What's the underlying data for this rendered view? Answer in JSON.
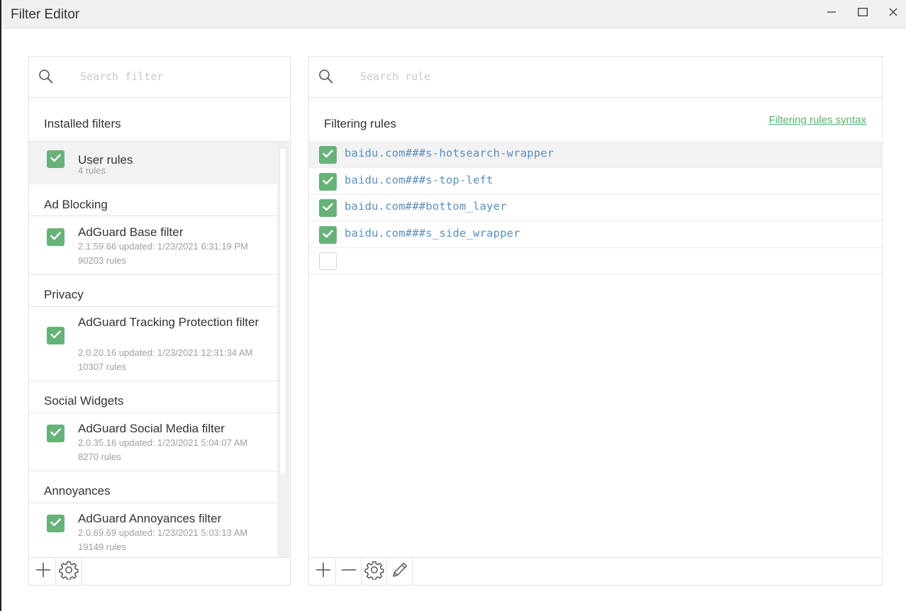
{
  "window": {
    "title": "Filter Editor",
    "minimize_icon": "minimize-icon",
    "maximize_icon": "maximize-icon",
    "close_icon": "close-icon"
  },
  "left_panel": {
    "search": {
      "placeholder": "Search filter",
      "value": ""
    },
    "installed_header": "Installed filters",
    "user_rules": {
      "name": "User rules",
      "meta": "4 rules",
      "checked": true
    },
    "groups": [
      {
        "header": "Ad Blocking",
        "filter": {
          "name": "AdGuard Base filter",
          "version": "2.1.59.66 updated: 1/23/2021 6:31:19 PM",
          "rules": "90203 rules",
          "checked": true
        }
      },
      {
        "header": "Privacy",
        "filter": {
          "name": "AdGuard Tracking Protection filter",
          "version": "2.0.20.16 updated: 1/23/2021 12:31:34 AM",
          "rules": "10307 rules",
          "checked": true
        }
      },
      {
        "header": "Social Widgets",
        "filter": {
          "name": "AdGuard Social Media filter",
          "version": "2.0.35.16 updated: 1/23/2021 5:04:07 AM",
          "rules": "8270 rules",
          "checked": true
        }
      },
      {
        "header": "Annoyances",
        "filter": {
          "name": "AdGuard Annoyances filter",
          "version": "2.0.69.69 updated: 1/23/2021 5:03:13 AM",
          "rules": "19149 rules",
          "checked": true
        }
      }
    ],
    "toolbar": [
      "plus-icon",
      "gear-icon"
    ]
  },
  "right_panel": {
    "search": {
      "placeholder": "Search rule",
      "value": ""
    },
    "title": "Filtering rules",
    "syntax_link": "Filtering rules syntax",
    "rules": [
      {
        "text": "baidu.com###s-hotsearch-wrapper",
        "checked": true
      },
      {
        "text": "baidu.com###s-top-left",
        "checked": true
      },
      {
        "text": "baidu.com###bottom_layer",
        "checked": true
      },
      {
        "text": "baidu.com###s_side_wrapper",
        "checked": true
      },
      {
        "text": "",
        "checked": false
      }
    ],
    "toolbar": [
      "plus-icon",
      "minus-icon",
      "gear-icon",
      "pencil-icon"
    ]
  },
  "colors": {
    "accent": "#67b279",
    "link": "#5cb16e",
    "rule_text": "#5b8fbf"
  }
}
